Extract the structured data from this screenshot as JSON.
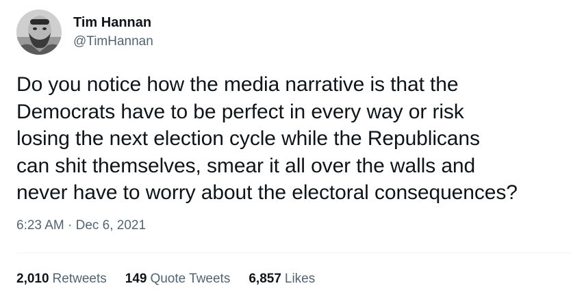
{
  "author": {
    "display_name": "Tim Hannan",
    "handle": "@TimHannan"
  },
  "tweet": {
    "lines": [
      "Do you notice how the media narrative is that the",
      "Democrats have to be perfect in every way or risk",
      "losing the next election cycle while the Republicans",
      "can shit themselves, smear it all over the walls and",
      "never have to worry about the electoral consequences?"
    ],
    "time": "6:23 AM",
    "separator": "·",
    "date": "Dec 6, 2021"
  },
  "stats": {
    "retweets_count": "2,010",
    "retweets_label": "Retweets",
    "quotes_count": "149",
    "quotes_label": "Quote Tweets",
    "likes_count": "6,857",
    "likes_label": "Likes"
  },
  "colors": {
    "text_primary": "#0f1419",
    "text_secondary": "#536471",
    "divider": "#eff3f4"
  }
}
